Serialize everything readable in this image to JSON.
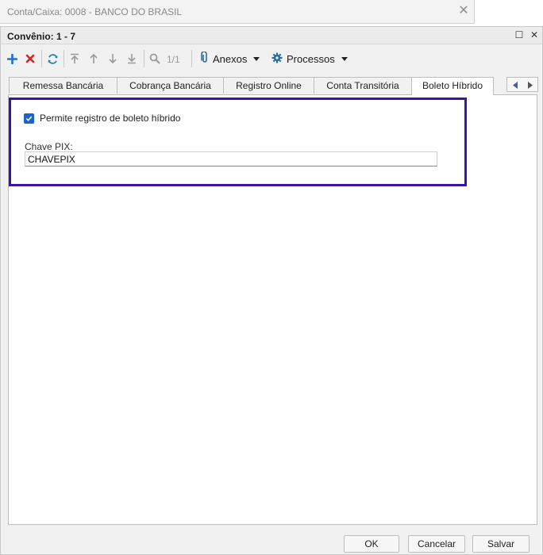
{
  "outer_window": {
    "title": "Conta/Caixa: 0008 - BANCO DO BRASIL",
    "close_glyph": "✕"
  },
  "dialog": {
    "title": "Convênio: 1 - 7",
    "maximize_glyph": "☐",
    "close_glyph": "✕"
  },
  "toolbar": {
    "page_indicator": "1/1",
    "anexos_label": "Anexos",
    "processos_label": "Processos",
    "icons": [
      "add-icon",
      "delete-icon",
      "refresh-icon",
      "first-record-icon",
      "previous-record-icon",
      "next-record-icon",
      "last-record-icon",
      "search-icon",
      "paperclip-icon",
      "gear-icon"
    ]
  },
  "tabs": [
    {
      "label": "Remessa Bancária",
      "active": false
    },
    {
      "label": "Cobrança Bancária",
      "active": false
    },
    {
      "label": "Registro Online",
      "active": false
    },
    {
      "label": "Conta Transitória",
      "active": false
    },
    {
      "label": "Boleto Híbrido",
      "active": true
    }
  ],
  "panel": {
    "checkbox_label": "Permite registro de boleto híbrido",
    "checkbox_checked": true,
    "pix_label": "Chave PIX:",
    "pix_value": "CHAVEPIX"
  },
  "buttons": {
    "ok": "OK",
    "cancel": "Cancelar",
    "save": "Salvar"
  },
  "colors": {
    "highlight_border": "#3a12b0",
    "add_icon": "#1f6fd1",
    "delete_icon": "#d32424",
    "refresh_icon": "#1e7fa8",
    "checkbox": "#1f63c7"
  }
}
